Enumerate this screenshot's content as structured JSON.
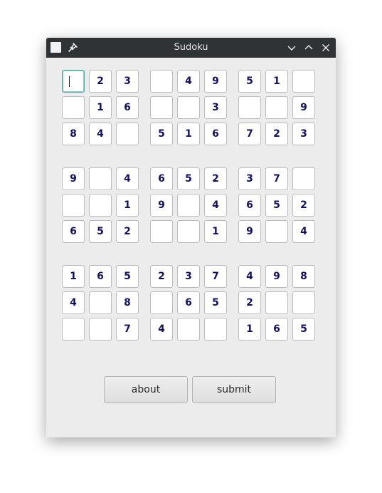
{
  "window": {
    "title": "Sudoku",
    "icons": [
      "window-menu-icon",
      "pin-icon",
      "minimize-icon",
      "maximize-icon",
      "close-icon"
    ]
  },
  "board": {
    "rows": [
      [
        "",
        "2",
        "3",
        "",
        "4",
        "9",
        "5",
        "1",
        ""
      ],
      [
        "",
        "1",
        "6",
        "",
        "",
        "3",
        "",
        "",
        "9"
      ],
      [
        "8",
        "4",
        "",
        "5",
        "1",
        "6",
        "7",
        "2",
        "3"
      ],
      [
        "9",
        "",
        "4",
        "6",
        "5",
        "2",
        "3",
        "7",
        ""
      ],
      [
        "",
        "",
        "1",
        "9",
        "",
        "4",
        "6",
        "5",
        "2"
      ],
      [
        "6",
        "5",
        "2",
        "",
        "",
        "1",
        "9",
        "",
        "4"
      ],
      [
        "1",
        "6",
        "5",
        "2",
        "3",
        "7",
        "4",
        "9",
        "8"
      ],
      [
        "4",
        "",
        "8",
        "",
        "6",
        "5",
        "2",
        "",
        ""
      ],
      [
        "",
        "",
        "7",
        "4",
        "",
        "",
        "1",
        "6",
        "5"
      ]
    ],
    "focused_cell": [
      0,
      0
    ]
  },
  "buttons": {
    "about_label": "about",
    "submit_label": "submit"
  },
  "colors": {
    "digit": "#11116a",
    "titlebar": "#2f3336",
    "focus_border": "#4ba79a"
  }
}
